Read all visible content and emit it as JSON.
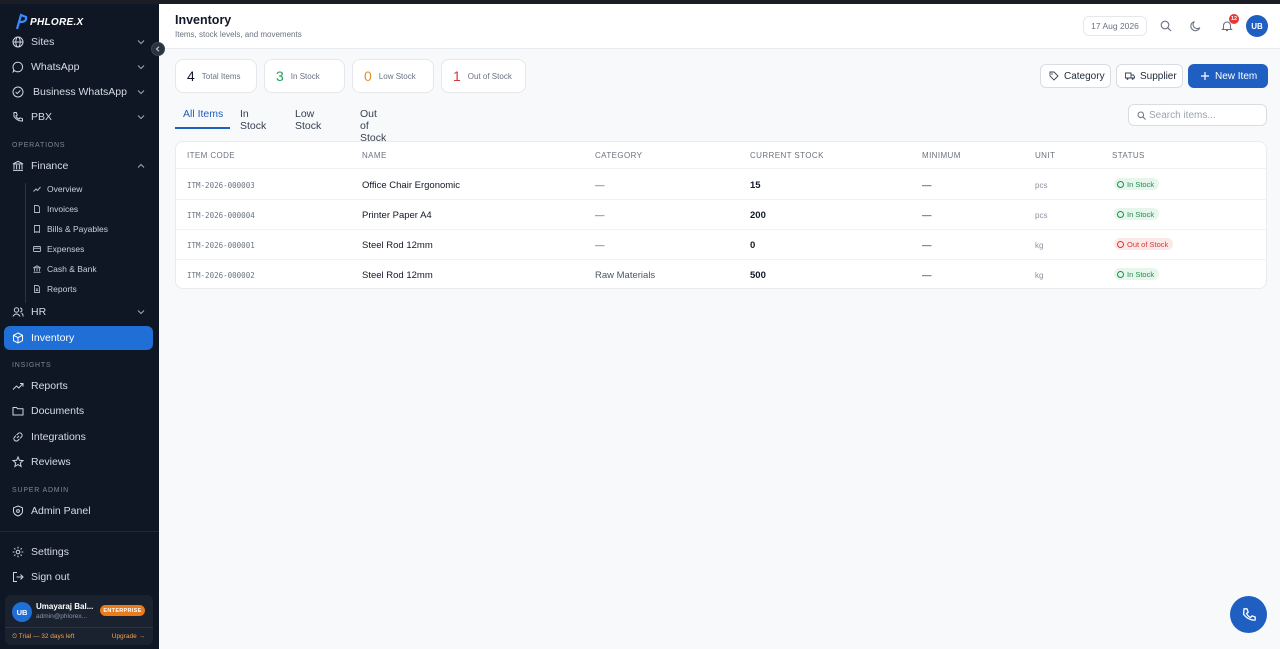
{
  "brand": {
    "logo_text": "PHLORE.X"
  },
  "sidebar": {
    "items_top": [
      {
        "label": "Sites",
        "icon": "globe-icon"
      },
      {
        "label": "WhatsApp",
        "icon": "chat-icon"
      },
      {
        "label": "Business WhatsApp",
        "icon": "whatsapp-icon"
      },
      {
        "label": "PBX",
        "icon": "phone-icon"
      }
    ],
    "section_operations": "OPERATIONS",
    "finance": {
      "label": "Finance",
      "sub": [
        "Overview",
        "Invoices",
        "Bills & Payables",
        "Expenses",
        "Cash & Bank",
        "Reports"
      ]
    },
    "hr": "HR",
    "inventory": "Inventory",
    "section_insights": "INSIGHTS",
    "insights": [
      "Reports",
      "Documents",
      "Integrations",
      "Reviews"
    ],
    "section_superadmin": "SUPER ADMIN",
    "admin_panel": "Admin Panel",
    "settings": "Settings",
    "sign_out": "Sign out",
    "user": {
      "initials": "UB",
      "name": "Umayaraj Bal...",
      "email": "admin@phlorex...",
      "plan": "ENTERPRISE",
      "trial": "⏲ Trial — 32 days left",
      "upgrade": "Upgrade →"
    }
  },
  "header": {
    "title": "Inventory",
    "subtitle": "Items, stock levels, and movements",
    "date": "17 Aug 2026",
    "notif_count": "12",
    "avatar_initials": "UB"
  },
  "stats": [
    {
      "value": "4",
      "label": "Total Items",
      "color": "#111827"
    },
    {
      "value": "3",
      "label": "In Stock",
      "color": "#22a05a"
    },
    {
      "value": "0",
      "label": "Low Stock",
      "color": "#e0912a"
    },
    {
      "value": "1",
      "label": "Out of Stock",
      "color": "#d13b3b"
    }
  ],
  "actions": {
    "category": "Category",
    "supplier": "Supplier",
    "new_item": "New Item"
  },
  "tabs": [
    "All Items",
    "In Stock",
    "Low Stock",
    "Out of Stock"
  ],
  "search": {
    "placeholder": "Search items..."
  },
  "table": {
    "headers": [
      "ITEM CODE",
      "NAME",
      "CATEGORY",
      "CURRENT STOCK",
      "MINIMUM",
      "UNIT",
      "STATUS"
    ],
    "rows": [
      {
        "code": "ITM-2026-000003",
        "name": "Office Chair Ergonomic",
        "category": "—",
        "stock": "15",
        "minimum": "—",
        "unit": "pcs",
        "status": "In Stock",
        "status_kind": "ok"
      },
      {
        "code": "ITM-2026-000004",
        "name": "Printer Paper A4",
        "category": "—",
        "stock": "200",
        "minimum": "—",
        "unit": "pcs",
        "status": "In Stock",
        "status_kind": "ok"
      },
      {
        "code": "ITM-2026-000001",
        "name": "Steel Rod 12mm",
        "category": "—",
        "stock": "0",
        "minimum": "—",
        "unit": "kg",
        "status": "Out of Stock",
        "status_kind": "out"
      },
      {
        "code": "ITM-2026-000002",
        "name": "Steel Rod 12mm",
        "category": "Raw Materials",
        "stock": "500",
        "minimum": "—",
        "unit": "kg",
        "status": "In Stock",
        "status_kind": "ok"
      }
    ]
  },
  "colors": {
    "accent": "#1f5fc2",
    "sidebar_bg": "#0f1724",
    "active_nav": "#1f6fd6"
  }
}
